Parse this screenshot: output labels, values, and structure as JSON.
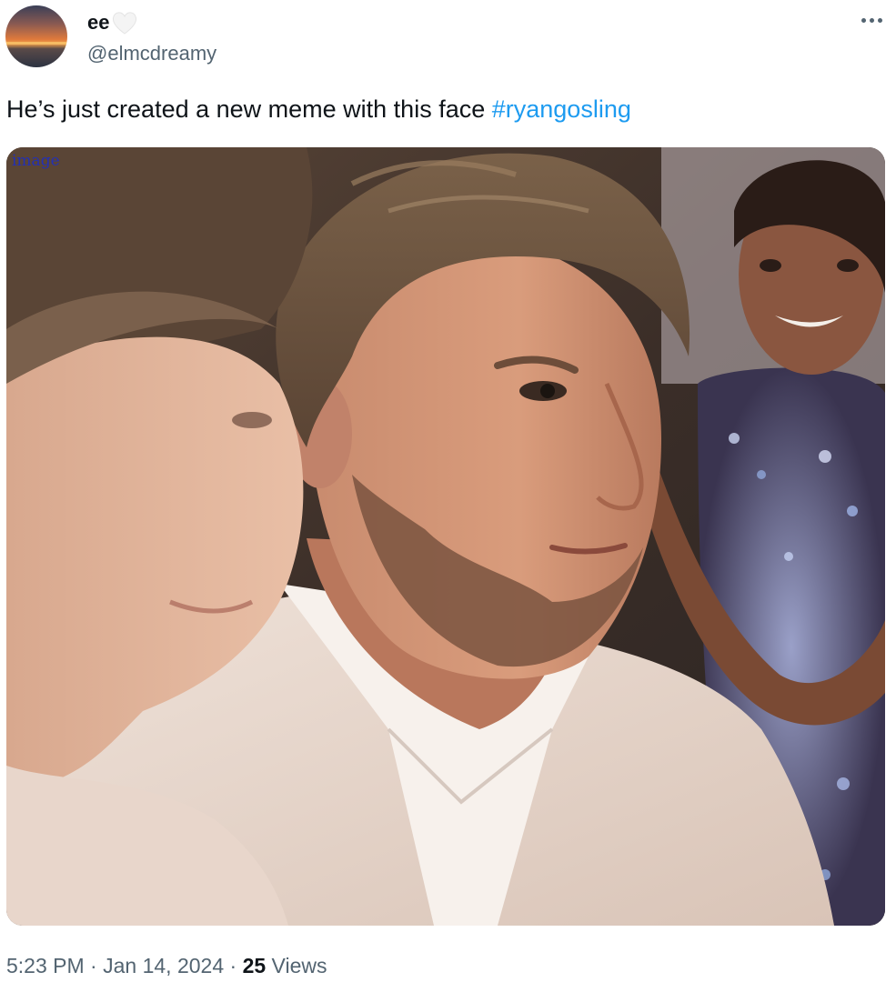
{
  "author": {
    "display_name": "ee",
    "handle": "@elmcdreamy",
    "badge_icon": "white-heart-icon",
    "avatar_icon": "sunset-avatar"
  },
  "tweet": {
    "text": "He’s just created a new meme with this face ",
    "hashtag": "#ryangosling"
  },
  "media": {
    "alt_label": "image",
    "description_icon": "photo-media"
  },
  "meta": {
    "time": "5:23 PM",
    "separator": "·",
    "date": "Jan 14, 2024",
    "views_count": "25",
    "views_label": " Views"
  },
  "colors": {
    "text_primary": "#0f1419",
    "text_secondary": "#536471",
    "accent": "#1d9bf0"
  }
}
